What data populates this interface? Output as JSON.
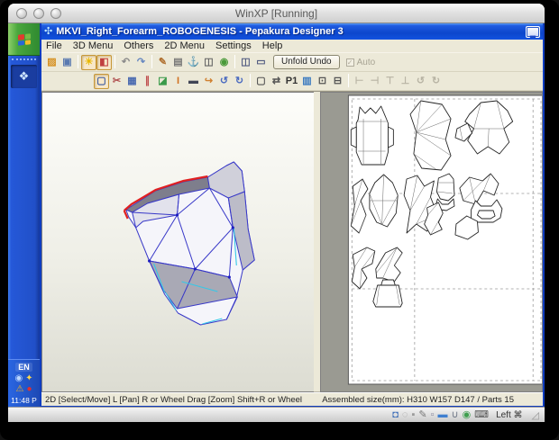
{
  "vm": {
    "window_title": "WinXP [Running]",
    "host_key_label": "Left ⌘",
    "status_icons": [
      {
        "name": "harddisk-icon",
        "glyph": "◘",
        "color": "#3f6fb8"
      },
      {
        "name": "optical-disc-icon",
        "glyph": "◌",
        "color": "#9a9a9a"
      },
      {
        "name": "floppy-icon",
        "glyph": "▪",
        "color": "#9a9a9a"
      },
      {
        "name": "tablet-pen-icon",
        "glyph": "✎",
        "color": "#777777"
      },
      {
        "name": "clipboard-icon",
        "glyph": "▫",
        "color": "#8a8aa0"
      },
      {
        "name": "display-icon",
        "glyph": "▬",
        "color": "#3f7fd0"
      },
      {
        "name": "usb-icon",
        "glyph": "∪",
        "color": "#707888"
      },
      {
        "name": "network-icon",
        "glyph": "◉",
        "color": "#3f9f4f"
      },
      {
        "name": "keyboard-capture-icon",
        "glyph": "⌨",
        "color": "#555555"
      }
    ]
  },
  "taskbar": {
    "language_indicator": "EN",
    "clock": "11:48 P",
    "tray_icons": [
      {
        "name": "volume-icon",
        "glyph": "◉",
        "color": "#bcd8ff"
      },
      {
        "name": "security-key-icon",
        "glyph": "✦",
        "color": "#ffd84a"
      },
      {
        "name": "security-alert-icon",
        "glyph": "⚠",
        "color": "#f0b020"
      },
      {
        "name": "antivirus-icon",
        "glyph": "●",
        "color": "#e03030"
      }
    ]
  },
  "app": {
    "title": "MKVI_Right_Forearm_ROBOGENESIS - Pepakura Designer 3",
    "menus": [
      "File",
      "3D Menu",
      "Others",
      "2D Menu",
      "Settings",
      "Help"
    ],
    "toolbar": {
      "unfold_undo_label": "Unfold Undo",
      "auto_label": "Auto",
      "auto_check_glyph": "✓",
      "main_icons": [
        {
          "name": "open-file-icon",
          "glyph": "▨",
          "color": "#d69020"
        },
        {
          "name": "save-file-icon",
          "glyph": "▣",
          "color": "#5a7ab0"
        },
        {
          "name": "separator",
          "sep": true
        },
        {
          "name": "light-toggle-icon",
          "glyph": "☀",
          "color": "#e8b800",
          "pressed": true
        },
        {
          "name": "texture-cube-icon",
          "glyph": "◧",
          "color": "#c04040",
          "pressed": true
        },
        {
          "name": "separator",
          "sep": true
        },
        {
          "name": "undo-icon",
          "glyph": "↶",
          "color": "#8a8a8a"
        },
        {
          "name": "redo-icon",
          "glyph": "↷",
          "color": "#6888c0"
        },
        {
          "name": "separator",
          "sep": true
        },
        {
          "name": "pen-tool-icon",
          "glyph": "✎",
          "color": "#b07030"
        },
        {
          "name": "print-icon",
          "glyph": "▤",
          "color": "#777777"
        },
        {
          "name": "anchor-icon",
          "glyph": "⚓",
          "color": "#445a88"
        },
        {
          "name": "part-box-icon",
          "glyph": "◫",
          "color": "#666666"
        },
        {
          "name": "joint-point-icon",
          "glyph": "◉",
          "color": "#4a9a3a"
        },
        {
          "name": "separator",
          "sep": true
        },
        {
          "name": "layout-both-views-icon",
          "glyph": "◫",
          "color": "#505a80"
        },
        {
          "name": "layout-single-view-icon",
          "glyph": "▭",
          "color": "#505a80"
        }
      ],
      "icons_2d": [
        {
          "name": "select-move-tool-icon",
          "glyph": "▢",
          "color": "#3a5aa0",
          "pressed": true
        },
        {
          "name": "edit-flaps-icon",
          "glyph": "✂",
          "color": "#b05050"
        },
        {
          "name": "texture-display-icon",
          "glyph": "▦",
          "color": "#4a6ab0"
        },
        {
          "name": "draw-lines-icon",
          "glyph": "∥",
          "color": "#c05050"
        },
        {
          "name": "glue-tab-icon",
          "glyph": "◪",
          "color": "#3a9a4a"
        },
        {
          "name": "text-tool-icon",
          "glyph": "I",
          "color": "#d07020"
        },
        {
          "name": "image-box-icon",
          "glyph": "▬",
          "color": "#404455"
        },
        {
          "name": "move-part-icon",
          "glyph": "↪",
          "color": "#d08030"
        },
        {
          "name": "rotate-ccw-icon",
          "glyph": "↺",
          "color": "#4a6ac0"
        },
        {
          "name": "rotate-cw-icon",
          "glyph": "↻",
          "color": "#4a6ac0"
        },
        {
          "name": "separator",
          "sep": true
        },
        {
          "name": "select-rect-icon",
          "glyph": "▢",
          "color": "#555555"
        },
        {
          "name": "arrange-parts-icon",
          "glyph": "⇄",
          "color": "#555555"
        },
        {
          "name": "page-number-icon",
          "glyph": "P1",
          "color": "#333333"
        },
        {
          "name": "scale-chart-icon",
          "glyph": "▥",
          "color": "#3a7ac0"
        },
        {
          "name": "check-sheet-icon",
          "glyph": "⊡",
          "color": "#555555"
        },
        {
          "name": "ruler-icon",
          "glyph": "⊟",
          "color": "#555555"
        },
        {
          "name": "separator",
          "sep": true
        },
        {
          "name": "align-left-icon",
          "glyph": "⊢",
          "disabled": true
        },
        {
          "name": "align-right-icon",
          "glyph": "⊣",
          "disabled": true
        },
        {
          "name": "align-top-icon",
          "glyph": "⊤",
          "disabled": true
        },
        {
          "name": "align-bottom-icon",
          "glyph": "⊥",
          "disabled": true
        },
        {
          "name": "rotate-left-disabled-icon",
          "glyph": "↺",
          "disabled": true
        },
        {
          "name": "rotate-right-disabled-icon",
          "glyph": "↻",
          "disabled": true
        }
      ]
    },
    "statusbar": {
      "left": "2D [Select/Move] L [Pan] R or Wheel Drag [Zoom] Shift+R or Wheel",
      "right": "Assembled size(mm): H310 W157 D147 / Parts 15"
    }
  },
  "colors": {
    "xp_titlebar_blue": "#0c46cc",
    "xp_taskbar_blue": "#2558d8",
    "toolbar_beige": "#ece9d8",
    "pattern_bg_gray": "#9a9a92",
    "model_edge_blue": "#3838c8",
    "model_open_edge_red": "#e02020",
    "model_edge_cyan": "#35c8e8"
  }
}
